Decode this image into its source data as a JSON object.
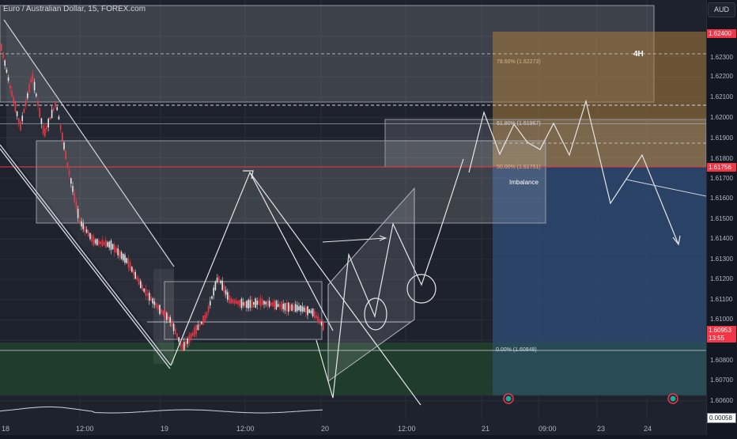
{
  "header": {
    "title": "Euro / Australian Dollar, 15, FOREX.com",
    "currency_button": "AUD"
  },
  "price_axis": {
    "labels": [
      "1.62300",
      "1.62200",
      "1.62100",
      "1.62000",
      "1.61900",
      "1.61800",
      "1.61700",
      "1.61600",
      "1.61500",
      "1.61400",
      "1.61300",
      "1.61200",
      "1.61100",
      "1.61000",
      "1.60800",
      "1.60700",
      "1.60600"
    ],
    "top_tag": "1.62400",
    "level_tag": "1.61756",
    "current_price": "1.60953",
    "countdown": "13:55",
    "oscillator_value": "0.00058"
  },
  "time_axis": {
    "labels": [
      "18",
      "12:00",
      "19",
      "12:00",
      "20",
      "12:00",
      "21",
      "09:00",
      "23",
      "24"
    ]
  },
  "annotations": {
    "fib_786": "78.60% (1.62273)",
    "fib_618": "61.80% (1.61967)",
    "fib_50": "50.00% (1.61751)",
    "fib_0": "0.00% (1.60848)",
    "timeframe_label": "4H",
    "imbalance_label": "Imbalance"
  },
  "colors": {
    "background": "#1e222d",
    "bull_candle": "#e6e6e6",
    "bear_candle": "#f23645",
    "supply_zone": "#8a6a3a",
    "demand_zone": "#1f3a2a",
    "projection_zone": "#2f4e7a",
    "level_line": "#f23645"
  }
}
